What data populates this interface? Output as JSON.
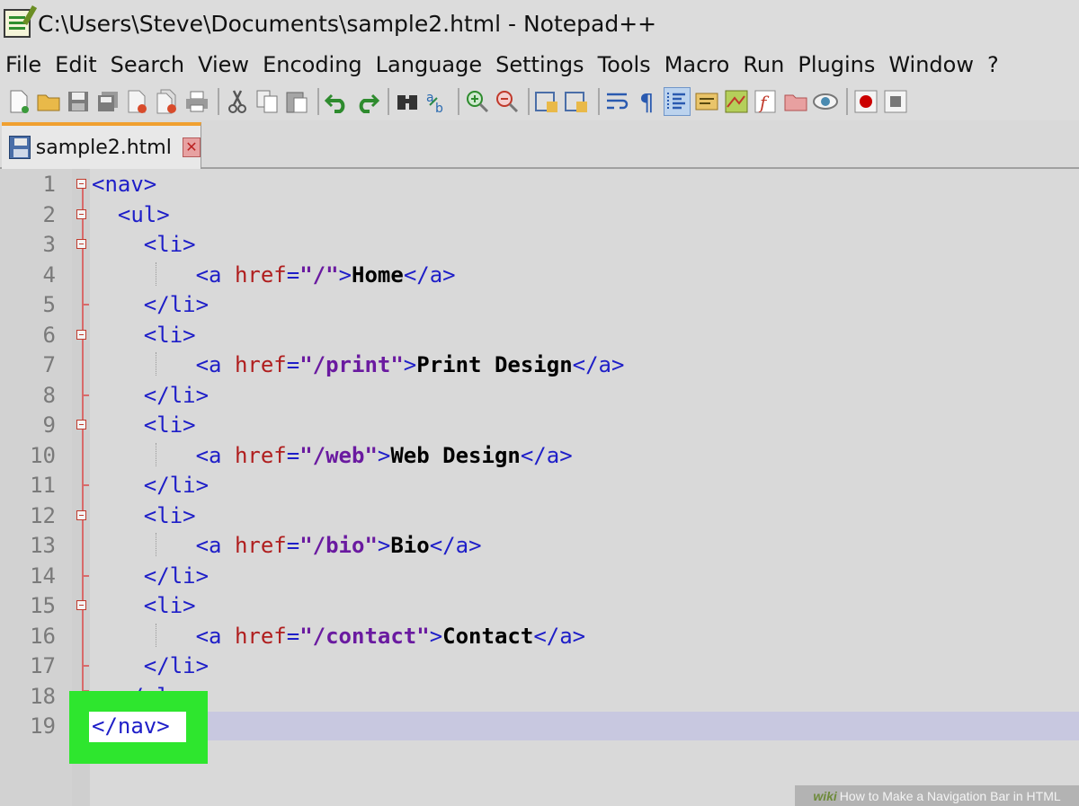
{
  "window": {
    "title": "C:\\Users\\Steve\\Documents\\sample2.html - Notepad++"
  },
  "menu": [
    "File",
    "Edit",
    "Search",
    "View",
    "Encoding",
    "Language",
    "Settings",
    "Tools",
    "Macro",
    "Run",
    "Plugins",
    "Window",
    "?"
  ],
  "toolbar": {
    "icons": [
      "new-file-icon",
      "open-file-icon",
      "save-icon",
      "save-all-icon",
      "close-icon",
      "close-all-icon",
      "print-icon",
      "cut-icon",
      "copy-icon",
      "paste-icon",
      "undo-icon",
      "redo-icon",
      "find-icon",
      "replace-icon",
      "zoom-in-icon",
      "zoom-out-icon",
      "sync-vertical-icon",
      "sync-horizontal-icon",
      "word-wrap-icon",
      "show-all-characters-icon",
      "indent-guide-icon",
      "user-language-icon",
      "document-map-icon",
      "function-list-icon",
      "folder-workspace-icon",
      "monitoring-icon",
      "record-macro-icon",
      "stop-record-icon"
    ]
  },
  "tab": {
    "label": "sample2.html"
  },
  "line_numbers": [
    "1",
    "2",
    "3",
    "4",
    "5",
    "6",
    "7",
    "8",
    "9",
    "10",
    "11",
    "12",
    "13",
    "14",
    "15",
    "16",
    "17",
    "18",
    "19"
  ],
  "code": {
    "l1": "<nav>",
    "l2": "<ul>",
    "l3": "<li>",
    "l4": {
      "open": "<a ",
      "attr": "href",
      "eq": "=",
      "val": "\"/\"",
      "close": ">",
      "text": "Home",
      "end": "</a>"
    },
    "l5": "</li>",
    "l6": "<li>",
    "l7": {
      "open": "<a ",
      "attr": "href",
      "eq": "=",
      "val": "\"/print\"",
      "close": ">",
      "text": "Print Design",
      "end": "</a>"
    },
    "l8": "</li>",
    "l9": "<li>",
    "l10": {
      "open": "<a ",
      "attr": "href",
      "eq": "=",
      "val": "\"/web\"",
      "close": ">",
      "text": "Web Design",
      "end": "</a>"
    },
    "l11": "</li>",
    "l12": "<li>",
    "l13": {
      "open": "<a ",
      "attr": "href",
      "eq": "=",
      "val": "\"/bio\"",
      "close": ">",
      "text": "Bio",
      "end": "</a>"
    },
    "l14": "</li>",
    "l15": "<li>",
    "l16": {
      "open": "<a ",
      "attr": "href",
      "eq": "=",
      "val": "\"/contact\"",
      "close": ">",
      "text": "Contact",
      "end": "</a>"
    },
    "l17": "</li>",
    "l18": "</ul>",
    "l19": "</nav>"
  },
  "watermark": {
    "brand": "wiki",
    "title": "How to Make a Navigation Bar in HTML"
  },
  "colors": {
    "tag": "#1e1ec8",
    "attribute": "#b01e1e",
    "string": "#6a1aa0",
    "highlight": "#2ee62e"
  }
}
